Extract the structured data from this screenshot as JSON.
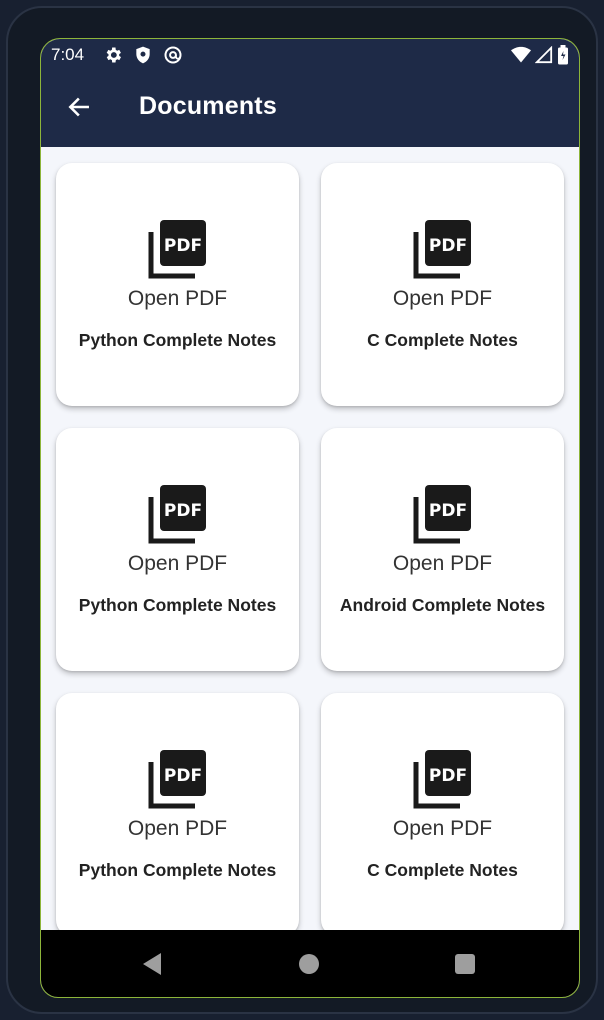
{
  "status_bar": {
    "time": "7:04",
    "left_icons": [
      "gear-icon",
      "shield-icon",
      "at-sign-icon"
    ],
    "right_icons": [
      "wifi-icon",
      "signal-icon",
      "battery-icon"
    ]
  },
  "app_bar": {
    "title": "Documents",
    "back_icon": "arrow-left-icon"
  },
  "documents": [
    {
      "action_label": "Open PDF",
      "title": "Python Complete Notes",
      "icon": "pdf-icon"
    },
    {
      "action_label": "Open PDF",
      "title": "C Complete Notes",
      "icon": "pdf-icon"
    },
    {
      "action_label": "Open PDF",
      "title": "Python Complete Notes",
      "icon": "pdf-icon"
    },
    {
      "action_label": "Open PDF",
      "title": "Android Complete Notes",
      "icon": "pdf-icon"
    },
    {
      "action_label": "Open PDF",
      "title": "Python Complete Notes",
      "icon": "pdf-icon"
    },
    {
      "action_label": "Open PDF",
      "title": "C Complete Notes",
      "icon": "pdf-icon"
    }
  ],
  "nav_bar": {
    "icons": [
      "nav-back-icon",
      "nav-home-icon",
      "nav-recents-icon"
    ]
  },
  "colors": {
    "app_bar": "#1e2a47",
    "background": "#f4f6fb",
    "card": "#ffffff"
  }
}
